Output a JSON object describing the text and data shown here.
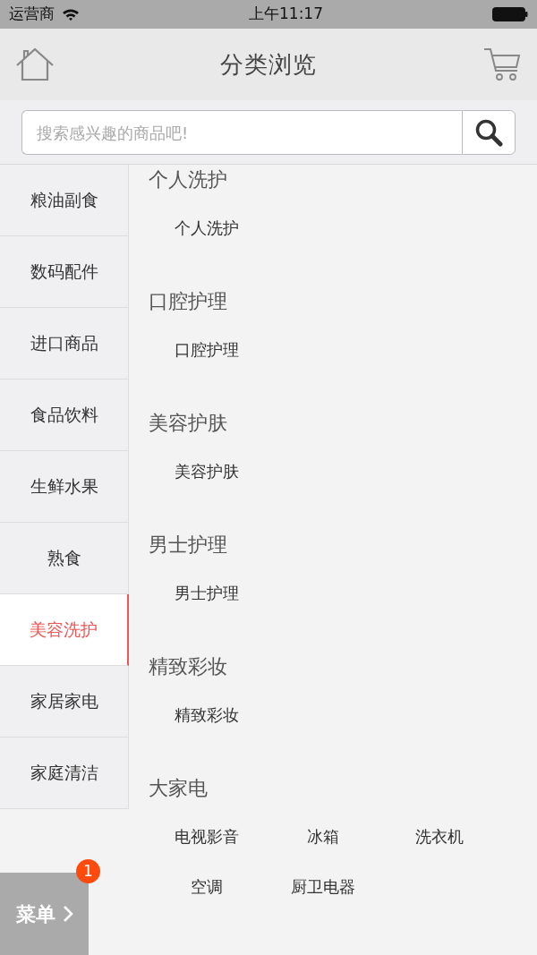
{
  "status_bar": {
    "carrier": "运营商",
    "time": "上午11:17"
  },
  "header": {
    "title": "分类浏览"
  },
  "search": {
    "placeholder": "搜索感兴趣的商品吧!"
  },
  "categories": [
    {
      "label": "粮油副食",
      "selected": false
    },
    {
      "label": "数码配件",
      "selected": false
    },
    {
      "label": "进口商品",
      "selected": false
    },
    {
      "label": "食品饮料",
      "selected": false
    },
    {
      "label": "生鲜水果",
      "selected": false
    },
    {
      "label": "熟食",
      "selected": false
    },
    {
      "label": "美容洗护",
      "selected": true
    },
    {
      "label": "家居家电",
      "selected": false
    },
    {
      "label": "家庭清洁",
      "selected": false
    }
  ],
  "sections": [
    {
      "title": "个人洗护",
      "items": [
        "个人洗护"
      ]
    },
    {
      "title": "口腔护理",
      "items": [
        "口腔护理"
      ]
    },
    {
      "title": "美容护肤",
      "items": [
        "美容护肤"
      ]
    },
    {
      "title": "男士护理",
      "items": [
        "男士护理"
      ]
    },
    {
      "title": "精致彩妆",
      "items": [
        "精致彩妆"
      ]
    },
    {
      "title": "大家电",
      "items": [
        "电视影音",
        "冰箱",
        "洗衣机",
        "空调",
        "厨卫电器"
      ]
    }
  ],
  "menu_button": {
    "label": "菜单",
    "badge": "1"
  }
}
